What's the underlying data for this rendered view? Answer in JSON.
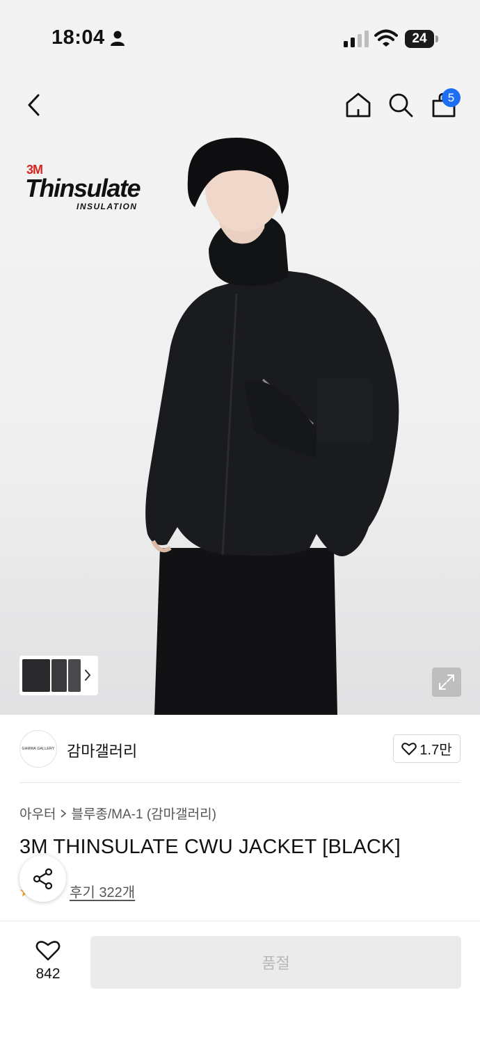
{
  "status_bar": {
    "time": "18:04",
    "battery": "24",
    "icons": [
      "person-icon",
      "signal-icon",
      "wifi-icon",
      "battery-icon"
    ]
  },
  "nav": {
    "cart_count": "5",
    "icons": [
      "back-icon",
      "home-icon",
      "search-icon",
      "shopping-bag-icon"
    ],
    "badge_color": "#1d6ef5"
  },
  "hero": {
    "logo": {
      "brand": "3M",
      "name": "Thinsulate",
      "sub": "INSULATION"
    },
    "icons": [
      "chevron-right-icon",
      "expand-icon"
    ]
  },
  "brand": {
    "avatar_text": "GAMMA GALLERY",
    "name": "감마갤러리",
    "likes": "1.7만"
  },
  "product": {
    "breadcrumb": [
      "아우터",
      "블루종/MA-1 (감마갤러리)"
    ],
    "title": "3M THINSULATE CWU JACKET [BLACK]",
    "reviews": "후기 322개",
    "icons": [
      "star-icon",
      "share-icon"
    ]
  },
  "bottom_bar": {
    "wish_count": "842",
    "soldout_label": "품절",
    "icons": [
      "heart-icon"
    ]
  }
}
